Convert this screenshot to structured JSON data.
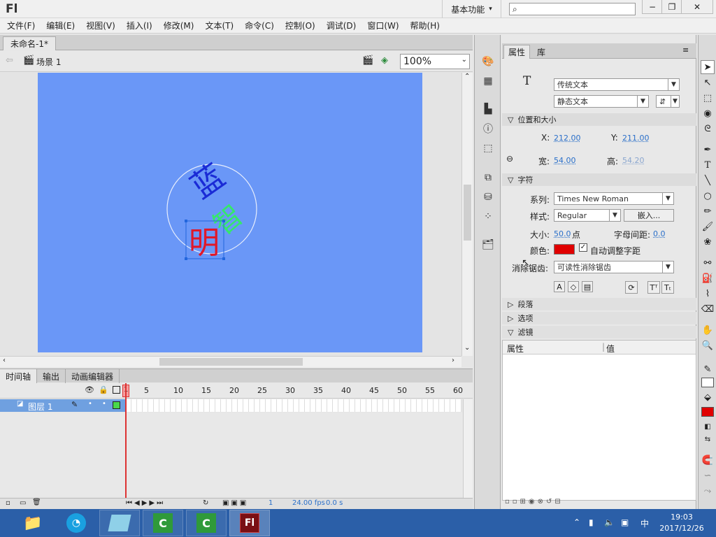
{
  "app": {
    "logo": "Fl",
    "workspace_label": "基本功能",
    "workspace_arrow": "▾",
    "minimize": "−",
    "restore": "❐",
    "close": "✕"
  },
  "menu": [
    "文件(F)",
    "编辑(E)",
    "视图(V)",
    "插入(I)",
    "修改(M)",
    "文本(T)",
    "命令(C)",
    "控制(O)",
    "调试(D)",
    "窗口(W)",
    "帮助(H)"
  ],
  "document": {
    "tab_title": "未命名-1*",
    "scene_label": "场景 1",
    "zoom": "100%"
  },
  "stage": {
    "bg_color": "#6a97f7",
    "texts": [
      {
        "char": "蓝",
        "color": "#1a2bd6"
      },
      {
        "char": "智",
        "color": "#35e86a"
      },
      {
        "char": "明",
        "color": "#e0182a"
      }
    ]
  },
  "timeline": {
    "tabs": [
      "时间轴",
      "输出",
      "动画编辑器"
    ],
    "frame_numbers": [
      "1",
      "5",
      "10",
      "15",
      "20",
      "25",
      "30",
      "35",
      "40",
      "45",
      "50",
      "55",
      "60"
    ],
    "layer_name": "图层 1",
    "current_frame": "1",
    "fps": "24.00 fps",
    "time": "0.0 s"
  },
  "properties": {
    "tabs": [
      "属性",
      "库"
    ],
    "text_engine": "传统文本",
    "text_type": "静态文本",
    "section_position": "位置和大小",
    "x_label": "X:",
    "x_value": "212.00",
    "y_label": "Y:",
    "y_value": "211.00",
    "w_label": "宽:",
    "w_value": "54.00",
    "h_label": "高:",
    "h_value": "54.20",
    "section_char": "字符",
    "family_label": "系列:",
    "family_value": "Times New Roman",
    "style_label": "样式:",
    "style_value": "Regular",
    "embed_label": "嵌入...",
    "size_label": "大小:",
    "size_value": "50.0",
    "size_unit": "点",
    "spacing_label": "字母间距:",
    "spacing_value": "0.0",
    "color_label": "颜色:",
    "color_value": "#e00000",
    "autokern_label": "自动调整字距",
    "antialias_label": "消除锯齿:",
    "antialias_value": "可读性消除锯齿",
    "section_para": "段落",
    "section_options": "选项",
    "section_filters": "滤镜",
    "filter_col_prop": "属性",
    "filter_col_value": "值"
  },
  "taskbar": {
    "time": "19:03",
    "date": "2017/12/26",
    "ime": "中",
    "flash_label": "Fl"
  }
}
